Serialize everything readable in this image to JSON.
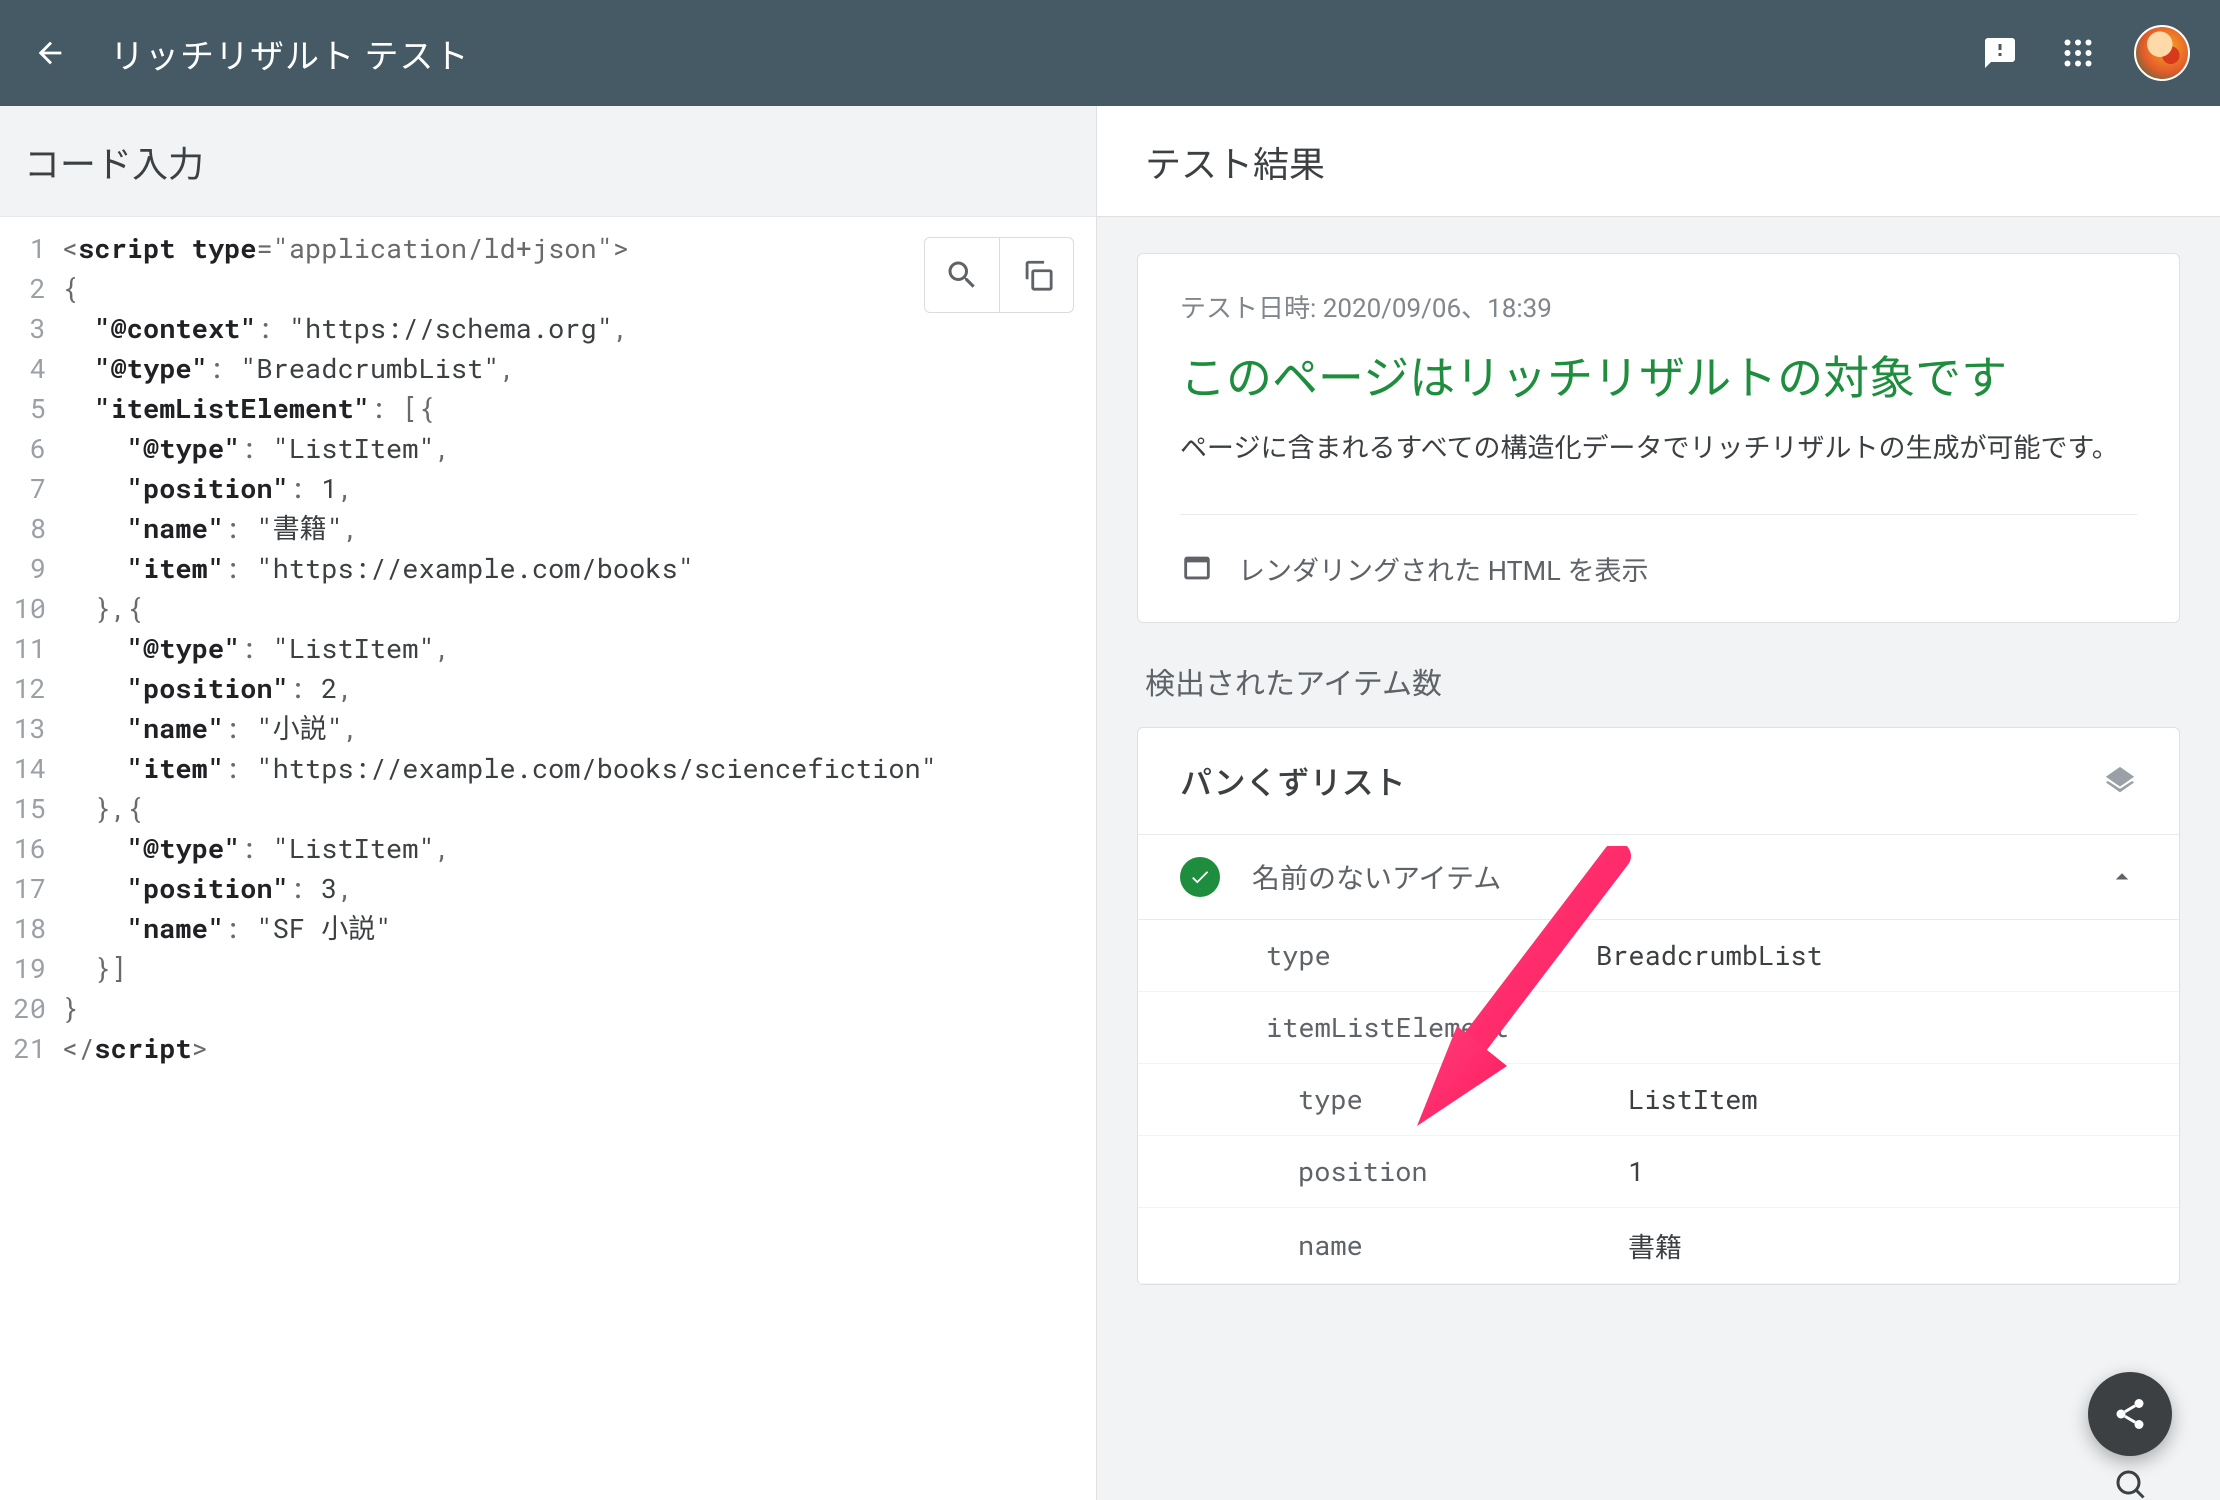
{
  "header": {
    "title": "リッチリザルト テスト"
  },
  "left": {
    "title": "コード入力",
    "code_lines": [
      "<script type=\"application/ld+json\">",
      "{",
      "  \"@context\": \"https://schema.org\",",
      "  \"@type\": \"BreadcrumbList\",",
      "  \"itemListElement\": [{",
      "    \"@type\": \"ListItem\",",
      "    \"position\": 1,",
      "    \"name\": \"書籍\",",
      "    \"item\": \"https://example.com/books\"",
      "  },{",
      "    \"@type\": \"ListItem\",",
      "    \"position\": 2,",
      "    \"name\": \"小説\",",
      "    \"item\": \"https://example.com/books/sciencefiction\"",
      "  },{",
      "    \"@type\": \"ListItem\",",
      "    \"position\": 3,",
      "    \"name\": \"SF 小説\"",
      "  }]",
      "}",
      "</script>"
    ]
  },
  "right": {
    "title": "テスト結果",
    "tested_at_label": "テスト日時: 2020/09/06、18:39",
    "headline": "このページはリッチリザルトの対象です",
    "description": "ページに含まれるすべての構造化データでリッチリザルトの生成が可能です。",
    "render_html_label": "レンダリングされた HTML を表示",
    "detected_label": "検出されたアイテム数",
    "group_title": "パンくずリスト",
    "item_name": "名前のないアイテム",
    "kv": [
      {
        "k": "type",
        "v": "BreadcrumbList",
        "sub": false
      },
      {
        "k": "itemListElement",
        "v": "",
        "sub": false
      },
      {
        "k": "type",
        "v": "ListItem",
        "sub": true
      },
      {
        "k": "position",
        "v": "1",
        "sub": true
      },
      {
        "k": "name",
        "v": "書籍",
        "sub": true
      }
    ]
  }
}
